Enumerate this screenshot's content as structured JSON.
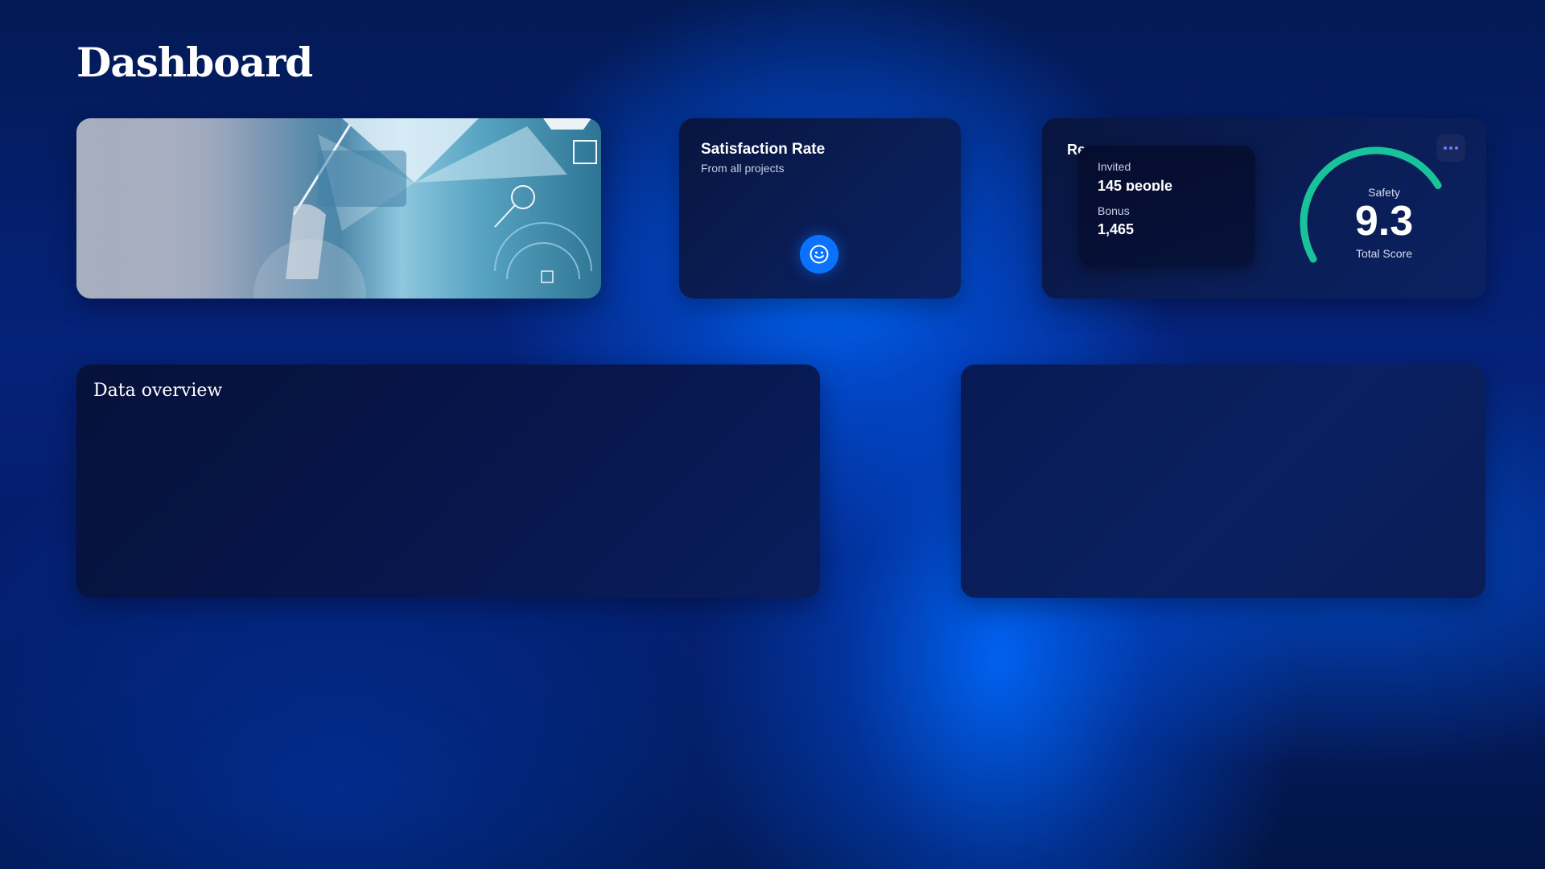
{
  "page": {
    "title": "Dashboard"
  },
  "hero": {
    "image": "technology-engineer-photo"
  },
  "satisfaction": {
    "title": "Satisfaction Rate",
    "subtitle": "From all projects",
    "icon": "smile-icon"
  },
  "referral": {
    "title": "Re",
    "invited_label": "Invited",
    "invited_value": "145 people",
    "bonus_label": "Bonus",
    "bonus_value": "1,465",
    "gauge": {
      "label": "Safety",
      "value": "9.3",
      "sublabel": "Total Score",
      "fraction": 0.93,
      "color": "#19c39a"
    },
    "more_icon": "more-dots-icon"
  },
  "overview": {
    "title": "Data overview"
  },
  "colors": {
    "accent": "#0a72ff",
    "gauge": "#19c39a"
  }
}
